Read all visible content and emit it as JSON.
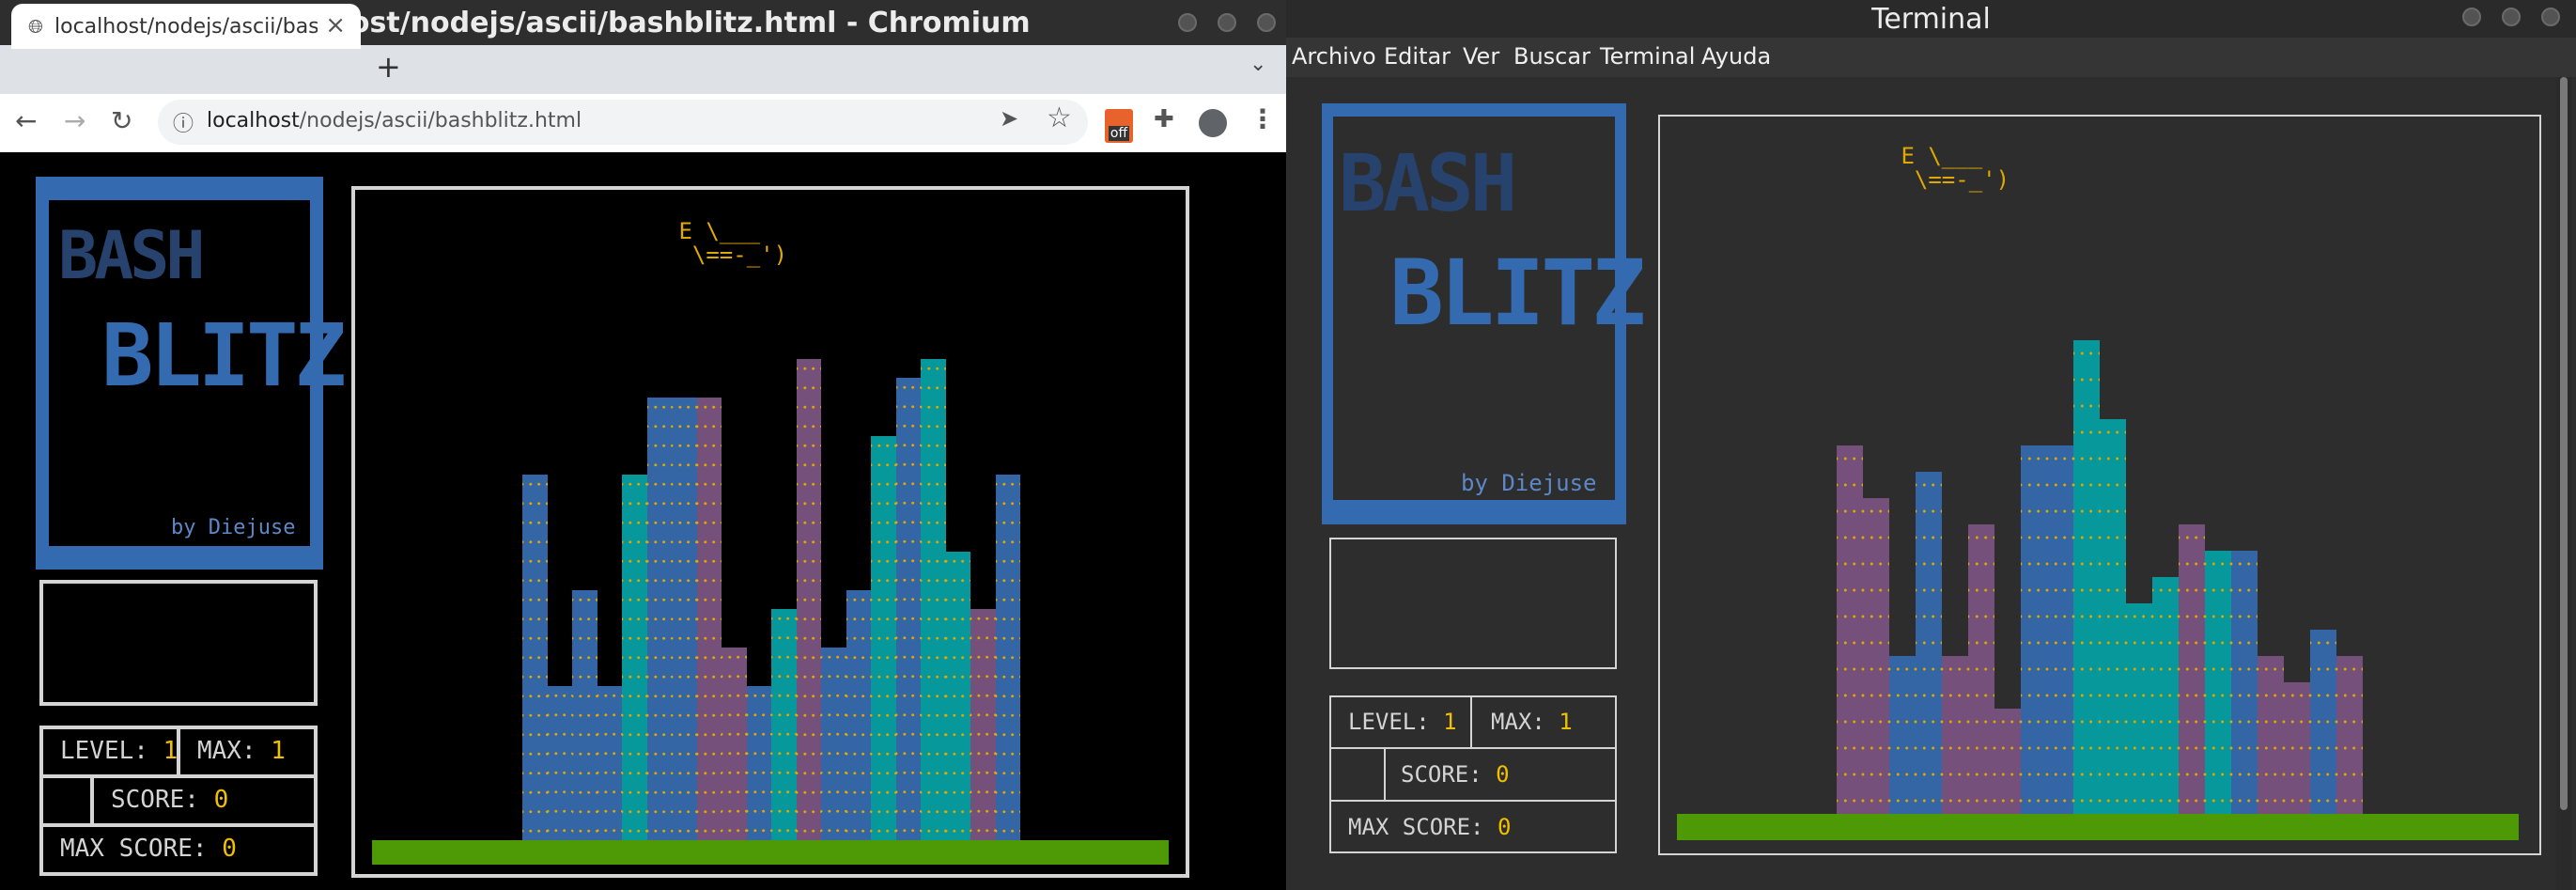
{
  "chromium": {
    "window_title": "localhost/nodejs/ascii/bashblitz.html - Chromium",
    "tab_title": "localhost/nodejs/ascii/bas",
    "tab_close": "×",
    "new_tab": "+",
    "tab_menu": "⌄",
    "url_host": "localhost",
    "url_path": "/nodejs/ascii/bashblitz.html",
    "back": "←",
    "forward": "→",
    "reload": "↻",
    "info": "ⓘ",
    "share": "➤",
    "star": "☆",
    "ext_badge": "off",
    "puzzle": "✚",
    "account": "●",
    "menu": "⋮"
  },
  "terminal": {
    "window_title": "Terminal",
    "menu": [
      "Archivo",
      "Editar",
      "Ver",
      "Buscar",
      "Terminal",
      "Ayuda"
    ]
  },
  "game": {
    "logo_line1": "BASH",
    "logo_line2": "BLITZ",
    "byline": "by Diejuse",
    "plane_line1": " E \\___",
    "plane_line2": "  \\==-_')",
    "labels": {
      "level": "LEVEL:",
      "max": "MAX:",
      "score": "SCORE:",
      "max_score": "MAX SCORE:"
    },
    "browser_values": {
      "level": "1",
      "max": "1",
      "score": "0",
      "max_score": "0"
    },
    "terminal_values": {
      "level": "1",
      "max": "1",
      "score": "0",
      "max_score": "0"
    },
    "colors": {
      "blue": "#3465a4",
      "teal": "#06989a",
      "purple": "#75507b",
      "green": "#4e9a06",
      "yellow": "#e0a800"
    },
    "browser_buildings": [
      {
        "h": 19,
        "c": "blue"
      },
      {
        "h": 8,
        "c": "blue"
      },
      {
        "h": 13,
        "c": "blue"
      },
      {
        "h": 8,
        "c": "blue"
      },
      {
        "h": 19,
        "c": "teal"
      },
      {
        "h": 23,
        "c": "blue"
      },
      {
        "h": 23,
        "c": "blue"
      },
      {
        "h": 23,
        "c": "purple"
      },
      {
        "h": 10,
        "c": "purple"
      },
      {
        "h": 8,
        "c": "blue"
      },
      {
        "h": 12,
        "c": "teal"
      },
      {
        "h": 25,
        "c": "purple"
      },
      {
        "h": 10,
        "c": "blue"
      },
      {
        "h": 13,
        "c": "blue"
      },
      {
        "h": 21,
        "c": "teal"
      },
      {
        "h": 24,
        "c": "blue"
      },
      {
        "h": 25,
        "c": "teal"
      },
      {
        "h": 15,
        "c": "teal"
      },
      {
        "h": 12,
        "c": "purple"
      },
      {
        "h": 19,
        "c": "blue"
      }
    ],
    "terminal_buildings": [
      {
        "h": 14,
        "c": "purple"
      },
      {
        "h": 12,
        "c": "purple"
      },
      {
        "h": 6,
        "c": "blue"
      },
      {
        "h": 13,
        "c": "blue"
      },
      {
        "h": 6,
        "c": "purple"
      },
      {
        "h": 11,
        "c": "purple"
      },
      {
        "h": 4,
        "c": "purple"
      },
      {
        "h": 14,
        "c": "blue"
      },
      {
        "h": 14,
        "c": "blue"
      },
      {
        "h": 18,
        "c": "teal"
      },
      {
        "h": 15,
        "c": "teal"
      },
      {
        "h": 8,
        "c": "teal"
      },
      {
        "h": 9,
        "c": "teal"
      },
      {
        "h": 11,
        "c": "purple"
      },
      {
        "h": 10,
        "c": "teal"
      },
      {
        "h": 10,
        "c": "blue"
      },
      {
        "h": 6,
        "c": "purple"
      },
      {
        "h": 5,
        "c": "purple"
      },
      {
        "h": 7,
        "c": "blue"
      },
      {
        "h": 6,
        "c": "purple"
      }
    ]
  }
}
